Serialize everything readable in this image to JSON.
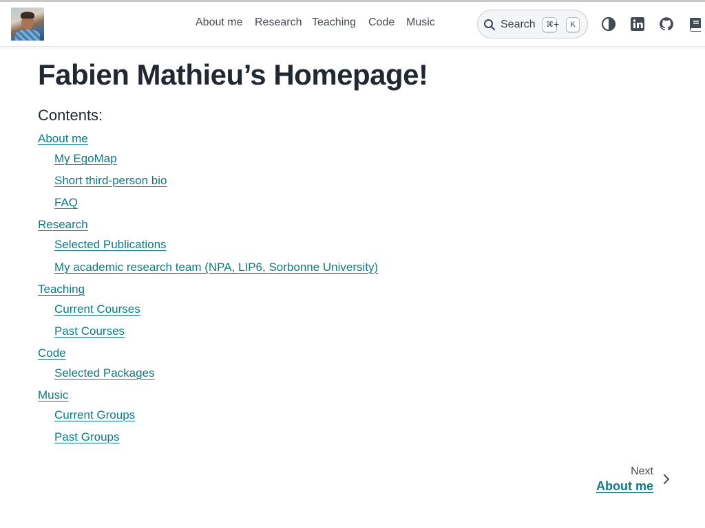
{
  "navbar": {
    "avatar_alt": "Fabien Mathieu",
    "links": [
      "About me",
      "Research",
      "Teaching",
      "Code",
      "Music"
    ],
    "search": {
      "label": "Search",
      "shortcut_cmd": "⌘",
      "shortcut_plus": "+",
      "shortcut_key": "K"
    },
    "icons": [
      "theme-toggle-icon",
      "linkedin-icon",
      "github-icon",
      "book-icon"
    ]
  },
  "page": {
    "title": "Fabien Mathieu’s Homepage!",
    "contents_caption": "Contents:"
  },
  "toc": [
    {
      "label": "About me",
      "children": [
        "My EgoMap",
        "Short third-person bio",
        "FAQ"
      ]
    },
    {
      "label": "Research",
      "children": [
        "Selected Publications",
        "My academic research team (NPA, LIP6, Sorbonne University)"
      ]
    },
    {
      "label": "Teaching",
      "children": [
        "Current Courses",
        "Past Courses"
      ]
    },
    {
      "label": "Code",
      "children": [
        "Selected Packages"
      ]
    },
    {
      "label": "Music",
      "children": [
        "Current Groups",
        "Past Groups"
      ]
    }
  ],
  "footer_nav": {
    "caption": "Next",
    "title": "About me"
  },
  "colors": {
    "link": "#0d7a86",
    "text": "#222832",
    "nav": "#434a54"
  }
}
